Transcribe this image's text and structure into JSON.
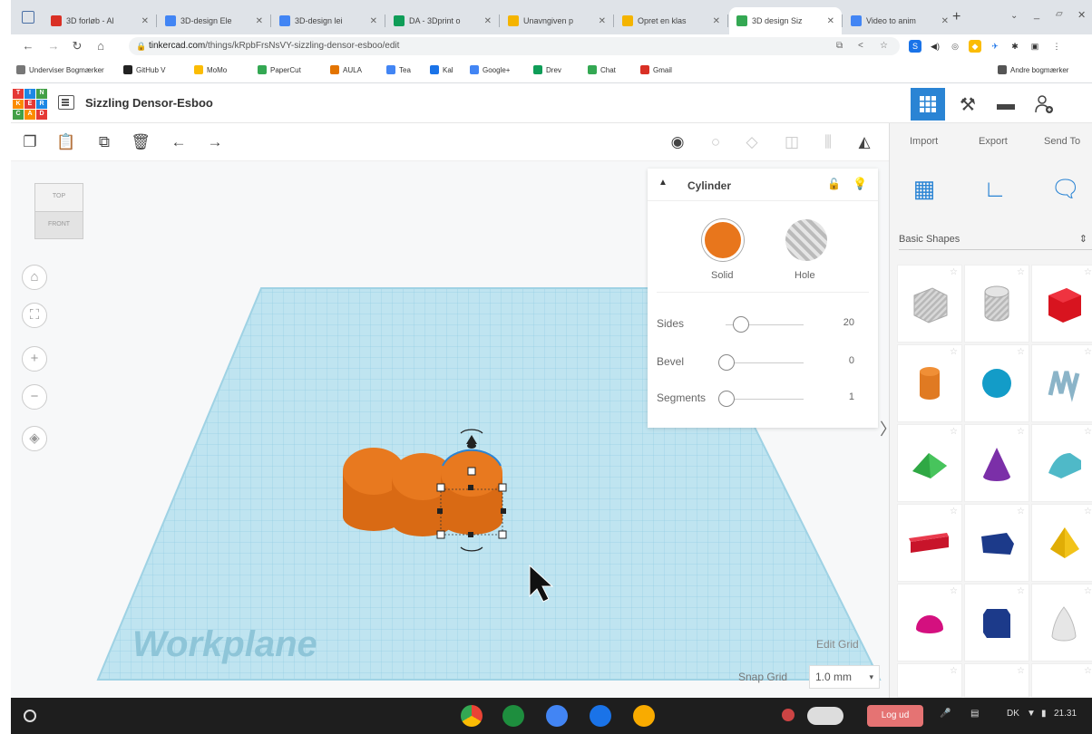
{
  "browser": {
    "tabs": [
      {
        "title": "3D forløb - Al",
        "color": "#d93025"
      },
      {
        "title": "3D-design Ele",
        "color": "#4285f4"
      },
      {
        "title": "3D-design lei",
        "color": "#4285f4"
      },
      {
        "title": "DA - 3Dprint o",
        "color": "#0f9d58"
      },
      {
        "title": "Unavngiven p",
        "color": "#f4b400"
      },
      {
        "title": "Opret en klas",
        "color": "#f4b400"
      },
      {
        "title": "3D design Siz",
        "color": "#34a853"
      },
      {
        "title": "Video to anim",
        "color": "#4285f4"
      }
    ],
    "active_tab": 6,
    "new_tab": "+",
    "url_host": "tinkercad.com",
    "url_path": "/things/kRpbFrsNsVY-sizzling-densor-esboo/edit",
    "bookmarks": [
      {
        "label": "Underviser Bogmærker",
        "color": "#777"
      },
      {
        "label": "GitHub V",
        "color": "#222"
      },
      {
        "label": "MoMo",
        "color": "#fbbc04"
      },
      {
        "label": "PaperCut",
        "color": "#34a853"
      },
      {
        "label": "AULA",
        "color": "#e37400"
      },
      {
        "label": "Tea",
        "color": "#4285f4"
      },
      {
        "label": "Kal",
        "color": "#1a73e8"
      },
      {
        "label": "Google+",
        "color": "#4285f4"
      },
      {
        "label": "Drev",
        "color": "#0f9d58"
      },
      {
        "label": "Chat",
        "color": "#34a853"
      },
      {
        "label": "Gmail",
        "color": "#d93025"
      }
    ],
    "other_bookmarks": "Andre bogmærker"
  },
  "app": {
    "logo_letters": [
      "T",
      "I",
      "N",
      "K",
      "E",
      "R",
      "C",
      "A",
      "D"
    ],
    "logo_colors": [
      "#e53935",
      "#1e88e5",
      "#43a047",
      "#fb8c00",
      "#e53935",
      "#1e88e5",
      "#43a047",
      "#fb8c00",
      "#e53935"
    ],
    "design_name": "Sizzling Densor-Esboo",
    "accent": "#2a84d4"
  },
  "panel": {
    "import": "Import",
    "export": "Export",
    "send_to": "Send To",
    "category": "Basic Shapes"
  },
  "inspector": {
    "title": "Cylinder",
    "solid_label": "Solid",
    "hole_label": "Hole",
    "solid_color": "#e8761c",
    "props": [
      {
        "label": "Sides",
        "value": "20"
      },
      {
        "label": "Bevel",
        "value": "0"
      },
      {
        "label": "Segments",
        "value": "1"
      }
    ]
  },
  "viewcube": {
    "top": "TOP",
    "front": "FRONT"
  },
  "workplane": {
    "label": "Workplane",
    "edit_grid": "Edit Grid",
    "snap_grid": "Snap Grid",
    "snap_value": "1.0 mm"
  },
  "taskbar": {
    "logout": "Log ud",
    "locale": "DK",
    "time": "21.31"
  }
}
